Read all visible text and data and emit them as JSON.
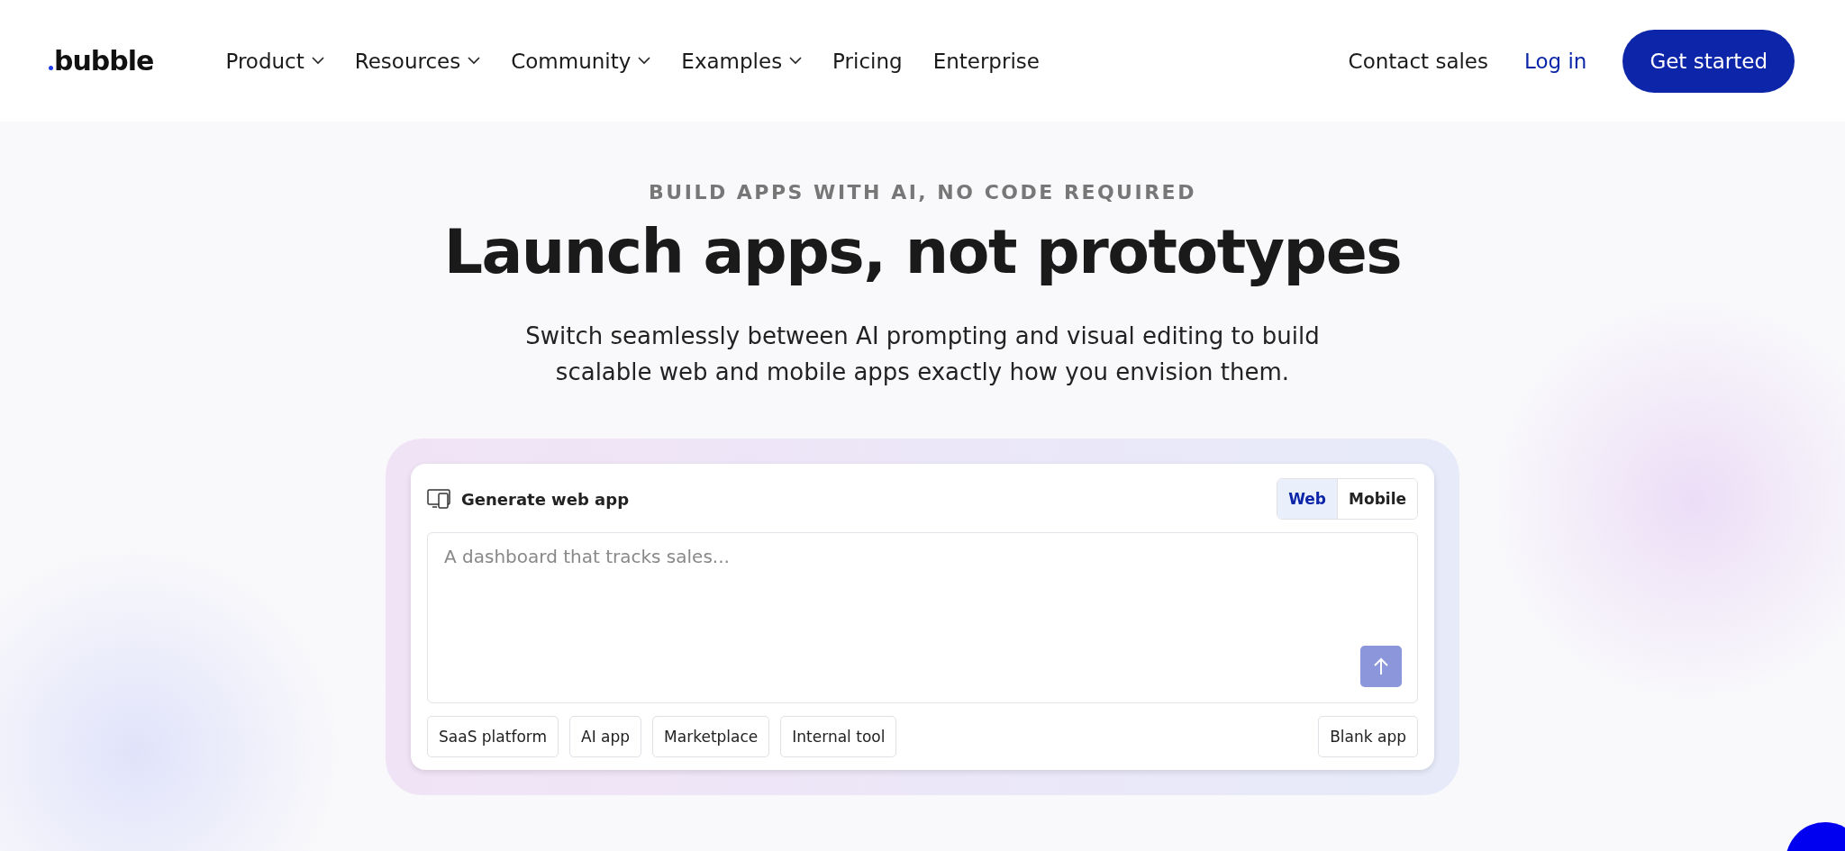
{
  "header": {
    "logo": "bubble",
    "nav": [
      {
        "label": "Product",
        "kind": "dropdown"
      },
      {
        "label": "Resources",
        "kind": "dropdown"
      },
      {
        "label": "Community",
        "kind": "dropdown"
      },
      {
        "label": "Examples",
        "kind": "dropdown"
      },
      {
        "label": "Pricing",
        "kind": "link"
      },
      {
        "label": "Enterprise",
        "kind": "link"
      }
    ],
    "contact": "Contact sales",
    "login": "Log in",
    "cta": "Get started"
  },
  "hero": {
    "eyebrow": "BUILD APPS WITH AI, NO CODE REQUIRED",
    "title": "Launch apps, not prototypes",
    "subtitle": "Switch seamlessly between AI prompting and visual editing to build scalable web and mobile apps exactly how you envision them."
  },
  "generator": {
    "title": "Generate web app",
    "modes": [
      {
        "label": "Web",
        "selected": true
      },
      {
        "label": "Mobile",
        "selected": false
      }
    ],
    "prompt": {
      "placeholder": "A dashboard that tracks sales..."
    },
    "templates": [
      "SaaS platform",
      "AI app",
      "Marketplace",
      "Internal tool"
    ],
    "blank": "Blank app"
  }
}
